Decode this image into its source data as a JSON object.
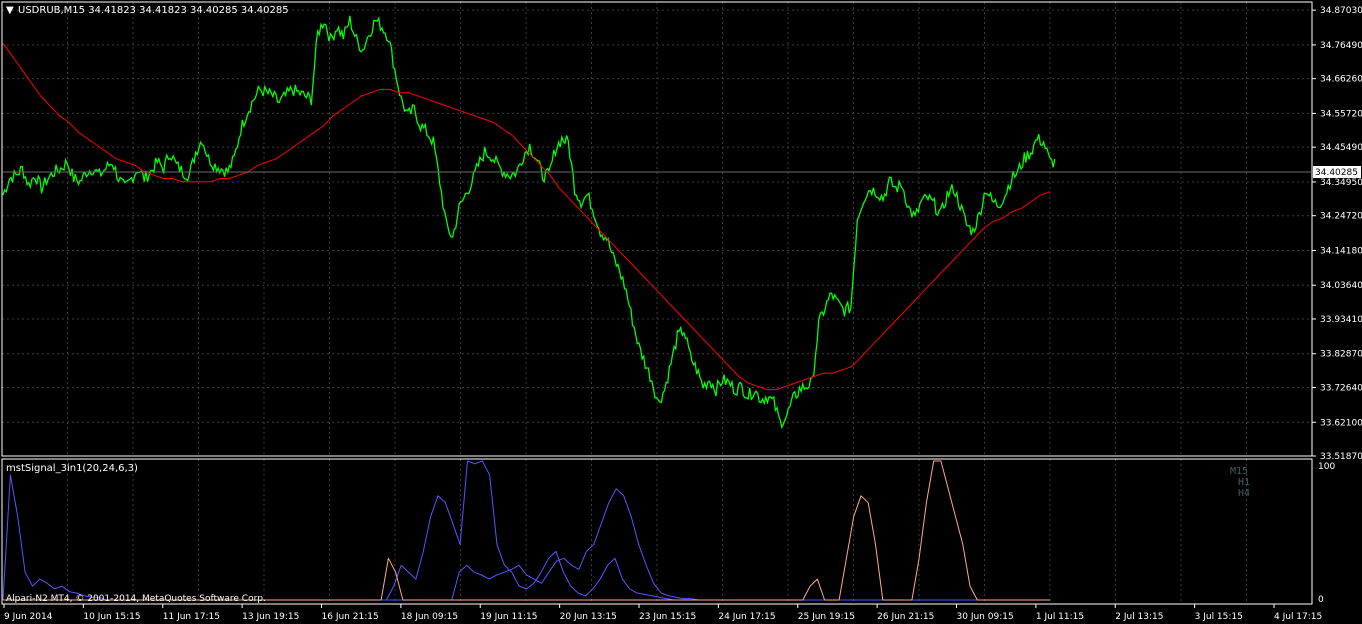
{
  "header": {
    "symbol_line": "USDRUB,M15  34.41823 34.41823 34.40285 34.40285",
    "current_price": "34.40285"
  },
  "indicator": {
    "title": "mstSignal_3in1(20,24,6,3)",
    "timeframes": [
      "M15",
      "H1",
      "H4"
    ],
    "scale_top": "100",
    "scale_bottom": "0"
  },
  "footer": {
    "copyright": "Alpari-N2 MT4, © 2001-2014, MetaQuotes Software Corp."
  },
  "colors": {
    "background": "#000000",
    "grid": "#3d3d3d",
    "price": "#00ff00",
    "moving_average": "#ff0000",
    "indicator_blue": "#5555ff",
    "indicator_orange": "#ffaa88",
    "axis": "#ffffff"
  },
  "chart_data": [
    {
      "type": "line",
      "title": "USDRUB,M15",
      "ylim": [
        33.5187,
        34.895
      ],
      "y_ticks": [
        "34.87030",
        "34.76490",
        "34.66260",
        "34.55720",
        "34.45490",
        "34.34950",
        "34.24720",
        "34.14180",
        "34.03640",
        "33.93410",
        "33.82870",
        "33.72640",
        "33.62100",
        "33.51870"
      ],
      "x_ticks": [
        "9 Jun 2014",
        "10 Jun 15:15",
        "11 Jun 17:15",
        "13 Jun 19:15",
        "16 Jun 21:15",
        "18 Jun 09:15",
        "19 Jun 11:15",
        "20 Jun 13:15",
        "23 Jun 15:15",
        "24 Jun 17:15",
        "25 Jun 19:15",
        "26 Jun 21:15",
        "30 Jun 09:15",
        "1 Jul 11:15",
        "2 Jul 13:15",
        "3 Jul 15:15",
        "4 Jul 17:15"
      ],
      "series": [
        {
          "values": [
            34.31,
            34.36,
            34.37,
            34.39,
            34.34,
            34.37,
            34.33,
            34.36,
            34.38,
            34.39,
            34.41,
            34.36,
            34.35,
            34.38,
            34.39,
            34.37,
            34.39,
            34.41,
            34.36,
            34.33,
            34.36,
            34.39,
            34.36,
            34.38,
            34.41,
            34.39,
            34.44,
            34.4,
            34.38,
            34.37,
            34.44,
            34.48,
            34.42,
            34.4,
            34.39,
            34.38,
            34.42,
            34.51,
            34.56,
            34.6,
            34.63,
            34.62,
            34.61,
            34.59,
            34.61,
            34.63,
            34.62,
            34.61,
            34.6,
            34.8,
            34.84,
            34.78,
            34.82,
            34.79,
            34.84,
            34.78,
            34.75,
            34.8,
            34.84,
            34.82,
            34.79,
            34.69,
            34.6,
            34.55,
            34.57,
            34.52,
            34.5,
            34.47,
            34.35,
            34.22,
            34.18,
            34.27,
            34.31,
            34.35,
            34.4,
            34.44,
            34.43,
            34.4,
            34.38,
            34.37,
            34.38,
            34.43,
            34.46,
            34.42,
            34.37,
            34.37,
            34.45,
            34.48,
            34.47,
            34.33,
            34.29,
            34.31,
            34.26,
            34.2,
            34.18,
            34.12,
            34.08,
            34.02,
            33.93,
            33.85,
            33.8,
            33.75,
            33.68,
            33.72,
            33.8,
            33.88,
            33.9,
            33.82,
            33.78,
            33.73,
            33.75,
            33.72,
            33.75,
            33.74,
            33.72,
            33.73,
            33.7,
            33.72,
            33.69,
            33.7,
            33.68,
            33.62,
            33.64,
            33.69,
            33.72,
            33.73,
            33.74,
            33.92,
            33.97,
            34.01,
            33.98,
            33.96,
            33.97,
            34.24,
            34.3,
            34.33,
            34.32,
            34.3,
            34.35,
            34.33,
            34.34,
            34.27,
            34.24,
            34.29,
            34.3,
            34.28,
            34.25,
            34.31,
            34.33,
            34.28,
            34.22,
            34.2,
            34.25,
            34.33,
            34.29,
            34.28,
            34.31,
            34.36,
            34.38,
            34.42,
            34.44,
            34.48,
            34.47,
            34.41
          ]
        },
        {
          "values": [
            34.77,
            34.73,
            34.69,
            34.65,
            34.61,
            34.58,
            34.55,
            34.53,
            34.5,
            34.48,
            34.46,
            34.44,
            34.42,
            34.41,
            34.4,
            34.38,
            34.37,
            34.36,
            34.36,
            34.35,
            34.35,
            34.35,
            34.35,
            34.36,
            34.36,
            34.37,
            34.38,
            34.4,
            34.41,
            34.42,
            34.44,
            34.46,
            34.48,
            34.5,
            34.52,
            34.55,
            34.57,
            34.59,
            34.61,
            34.62,
            34.63,
            34.63,
            34.62,
            34.62,
            34.61,
            34.6,
            34.59,
            34.58,
            34.57,
            34.56,
            34.55,
            34.54,
            34.53,
            34.51,
            34.49,
            34.46,
            34.43,
            34.4,
            34.37,
            34.33,
            34.3,
            34.27,
            34.24,
            34.21,
            34.18,
            34.15,
            34.12,
            34.09,
            34.06,
            34.03,
            34.0,
            33.97,
            33.94,
            33.91,
            33.88,
            33.85,
            33.82,
            33.79,
            33.76,
            33.74,
            33.73,
            33.72,
            33.72,
            33.73,
            33.74,
            33.75,
            33.76,
            33.77,
            33.77,
            33.78,
            33.79,
            33.82,
            33.85,
            33.88,
            33.91,
            33.94,
            33.97,
            34.0,
            34.03,
            34.06,
            34.09,
            34.12,
            34.15,
            34.18,
            34.21,
            34.23,
            34.24,
            34.26,
            34.27,
            34.29,
            34.31,
            34.32
          ]
        }
      ]
    },
    {
      "type": "line",
      "title": "mstSignal_3in1(20,24,6,3)",
      "ylim": [
        0,
        100
      ],
      "series": [
        {
          "name": "M15",
          "values": [
            0,
            90,
            60,
            20,
            10,
            15,
            12,
            8,
            10,
            6,
            5,
            3,
            2,
            2,
            0,
            0,
            0,
            0,
            0,
            0,
            0,
            0,
            0,
            0,
            0,
            0,
            0,
            0,
            0,
            0,
            0,
            0,
            0,
            0,
            0,
            0,
            0,
            0,
            0,
            0,
            0,
            0,
            0,
            0,
            0,
            0,
            0,
            0,
            0,
            0,
            0,
            0,
            0,
            10,
            25,
            20,
            15,
            35,
            60,
            75,
            70,
            55,
            40,
            100,
            98,
            100,
            90,
            40,
            25,
            20,
            10,
            8,
            12,
            20,
            30,
            35,
            20,
            10,
            5,
            3,
            8,
            15,
            25,
            30,
            15,
            8,
            5,
            4,
            3,
            2,
            1,
            0,
            0,
            0,
            0,
            0,
            0,
            0,
            0,
            0,
            0,
            0,
            0,
            0,
            0,
            0,
            0,
            0,
            0,
            0,
            0,
            0,
            0,
            0,
            0,
            0,
            0,
            0,
            0,
            0,
            0,
            0,
            0,
            0,
            0,
            0,
            0,
            0,
            0,
            0,
            0,
            0,
            0,
            0,
            0,
            0,
            0,
            0,
            0,
            0,
            0,
            0,
            0
          ]
        },
        {
          "name": "H1",
          "values": [
            0,
            0,
            0,
            0,
            0,
            0,
            0,
            0,
            0,
            0,
            0,
            0,
            0,
            0,
            0,
            0,
            0,
            0,
            0,
            0,
            0,
            0,
            0,
            0,
            0,
            0,
            0,
            0,
            0,
            0,
            0,
            0,
            0,
            0,
            0,
            0,
            0,
            0,
            0,
            0,
            0,
            0,
            0,
            0,
            0,
            0,
            0,
            0,
            0,
            0,
            0,
            0,
            0,
            0,
            0,
            0,
            0,
            0,
            0,
            0,
            0,
            20,
            25,
            20,
            18,
            15,
            18,
            20,
            22,
            25,
            18,
            15,
            12,
            20,
            28,
            30,
            25,
            22,
            35,
            40,
            55,
            70,
            80,
            75,
            60,
            40,
            25,
            12,
            5,
            3,
            2,
            1,
            1,
            0,
            0,
            0,
            0,
            0,
            0,
            0,
            0,
            0,
            0,
            0,
            0,
            0,
            0,
            0,
            0,
            0,
            0,
            0,
            0,
            0,
            0,
            0,
            0,
            0,
            0,
            0,
            0,
            0,
            0,
            0,
            0,
            0,
            0,
            0,
            0,
            0,
            0,
            0,
            0,
            0,
            0,
            0,
            0,
            0,
            0,
            0,
            0
          ]
        },
        {
          "name": "H4",
          "values": [
            0,
            0,
            0,
            0,
            0,
            0,
            0,
            0,
            0,
            0,
            0,
            0,
            0,
            0,
            0,
            0,
            0,
            0,
            0,
            0,
            0,
            0,
            0,
            0,
            0,
            0,
            0,
            0,
            0,
            0,
            0,
            0,
            0,
            0,
            0,
            0,
            0,
            0,
            0,
            0,
            0,
            0,
            0,
            0,
            0,
            0,
            0,
            0,
            0,
            0,
            0,
            0,
            0,
            30,
            20,
            0,
            0,
            0,
            0,
            0,
            0,
            0,
            0,
            0,
            0,
            0,
            0,
            0,
            0,
            0,
            0,
            0,
            0,
            0,
            0,
            0,
            0,
            0,
            0,
            0,
            0,
            0,
            0,
            0,
            0,
            0,
            0,
            0,
            0,
            0,
            0,
            0,
            0,
            0,
            0,
            0,
            0,
            0,
            0,
            0,
            0,
            0,
            0,
            0,
            0,
            0,
            0,
            0,
            0,
            0,
            0,
            10,
            15,
            0,
            0,
            0,
            30,
            60,
            75,
            70,
            40,
            0,
            0,
            0,
            0,
            0,
            30,
            70,
            100,
            100,
            80,
            60,
            40,
            10,
            0,
            0,
            0,
            0,
            0,
            0,
            0,
            0,
            0,
            0,
            0
          ]
        }
      ]
    }
  ]
}
